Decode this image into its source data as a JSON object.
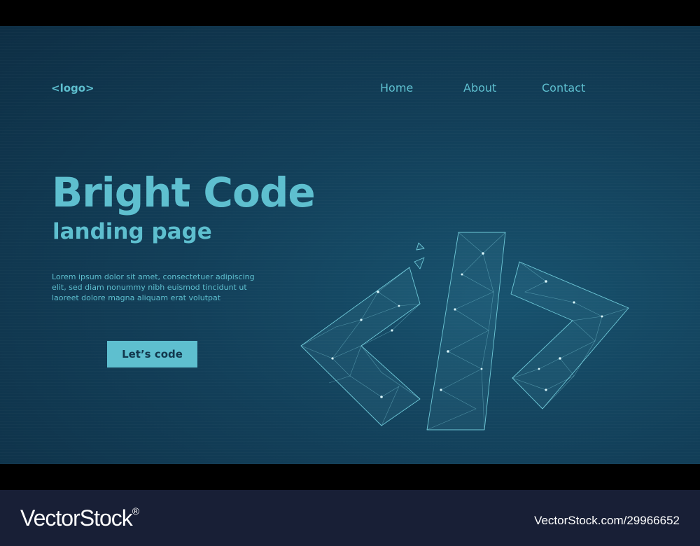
{
  "header": {
    "logo": "<logo>",
    "nav": [
      {
        "label": "Home"
      },
      {
        "label": "About"
      },
      {
        "label": "Contact"
      }
    ]
  },
  "hero": {
    "title": "Bright Code",
    "subtitle": "landing page",
    "body": "Lorem ipsum dolor sit amet, consectetuer adipiscing elit, sed diam nonummy nibh euismod tincidunt ut laoreet dolore magna aliquam erat volutpat",
    "cta_label": "Let’s code"
  },
  "illustration": {
    "icon": "code-brackets-icon"
  },
  "watermark": {
    "brand": "VectorStock",
    "registered": "®",
    "image_id": "VectorStock.com/29966652"
  },
  "colors": {
    "accent": "#5ebfcf",
    "background": "#123f59",
    "footer": "#181f36"
  }
}
